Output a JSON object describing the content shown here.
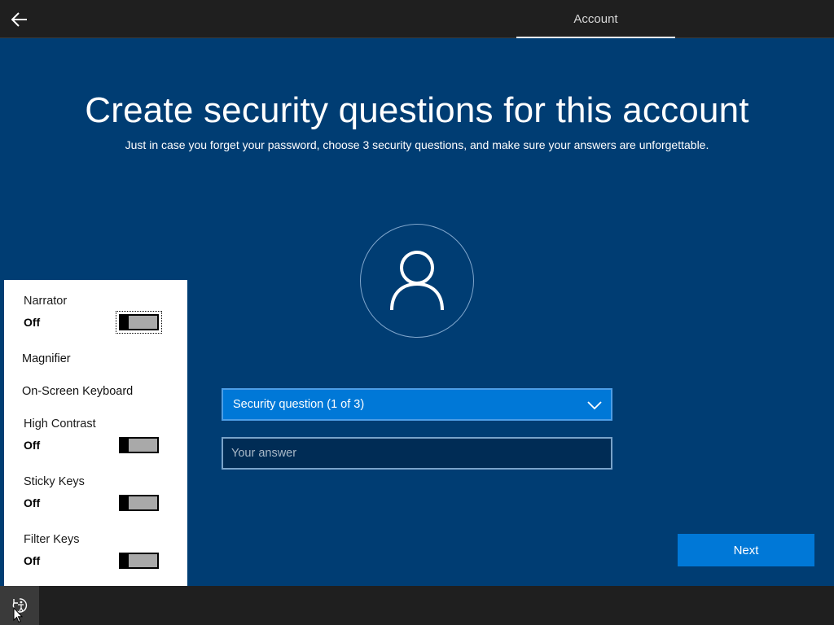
{
  "header": {
    "back_icon": "arrow-left-icon",
    "tab_label": "Account"
  },
  "page": {
    "title": "Create security questions for this account",
    "subtitle": "Just in case you forget your password, choose 3 security questions, and make sure your answers are unforgettable.",
    "avatar_icon": "user-icon"
  },
  "form": {
    "question_label": "Security question (1 of 3)",
    "answer_placeholder": "Your answer",
    "answer_value": "",
    "next_label": "Next"
  },
  "ease_of_access": {
    "narrator": {
      "label": "Narrator",
      "state": "Off"
    },
    "magnifier": {
      "label": "Magnifier"
    },
    "onscreen_keyboard": {
      "label": "On-Screen Keyboard"
    },
    "high_contrast": {
      "label": "High Contrast",
      "state": "Off"
    },
    "sticky_keys": {
      "label": "Sticky Keys",
      "state": "Off"
    },
    "filter_keys": {
      "label": "Filter Keys",
      "state": "Off"
    }
  },
  "footer": {
    "ease_icon": "ease-of-access-icon"
  },
  "colors": {
    "background": "#003d73",
    "accent": "#0078d7",
    "bar": "#1f1f1f"
  }
}
